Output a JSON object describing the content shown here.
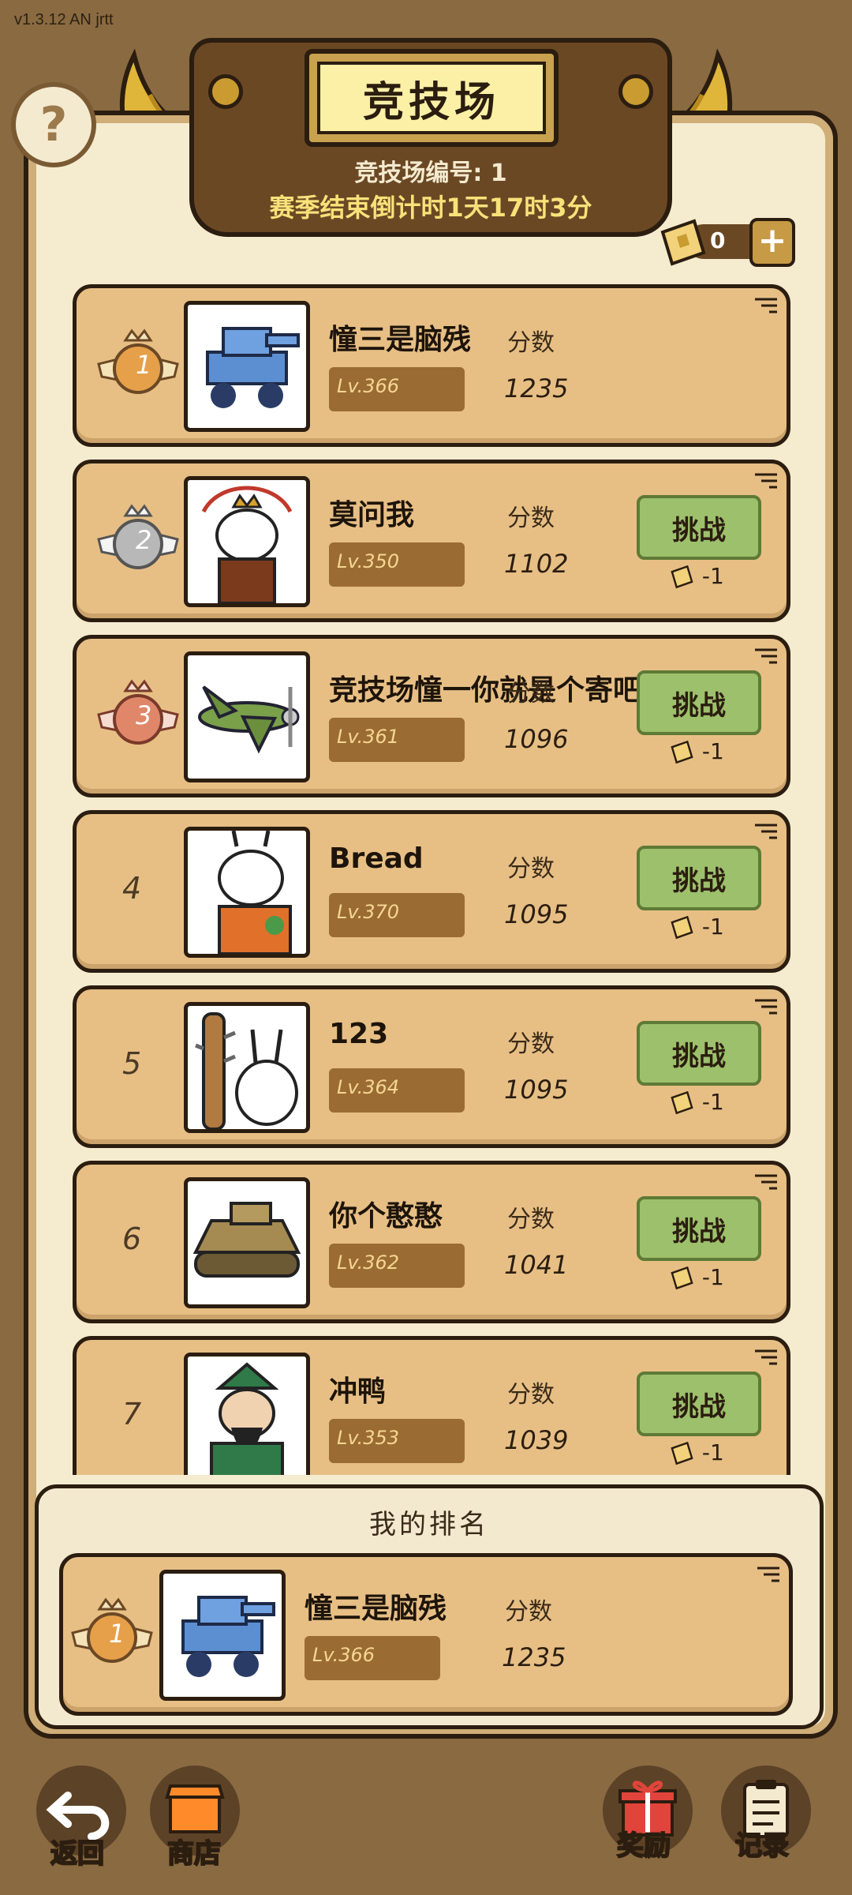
{
  "app": {
    "version": "v1.3.12 AN jrtt"
  },
  "header": {
    "help_glyph": "?",
    "title": "竞技场",
    "arena_number": "竞技场编号: 1",
    "season_countdown": "赛季结束倒计时1天17时3分"
  },
  "tickets": {
    "count": "0",
    "add_glyph": "+"
  },
  "score_label": "分数",
  "challenge_label": "挑战",
  "cost_label": "-1",
  "ranks": [
    {
      "rank": "1",
      "name": "憧三是脑残",
      "level": "Lv.366",
      "score": "1235",
      "medal": "gold",
      "portrait": "blue-tank",
      "challenge": false
    },
    {
      "rank": "2",
      "name": "莫问我",
      "level": "Lv.350",
      "score": "1102",
      "medal": "silver",
      "portrait": "monkey-king-rabbit",
      "challenge": true
    },
    {
      "rank": "3",
      "name": "竞技场憧一你就是个寄吧",
      "level": "Lv.361",
      "score": "1096",
      "medal": "bronze",
      "portrait": "green-plane",
      "challenge": true
    },
    {
      "rank": "4",
      "name": "Bread",
      "level": "Lv.370",
      "score": "1095",
      "medal": "none",
      "portrait": "chef-rabbit",
      "challenge": true
    },
    {
      "rank": "5",
      "name": "123",
      "level": "Lv.364",
      "score": "1095",
      "medal": "none",
      "portrait": "club-rabbit",
      "challenge": true
    },
    {
      "rank": "6",
      "name": "你个憨憨",
      "level": "Lv.362",
      "score": "1041",
      "medal": "none",
      "portrait": "khaki-tank",
      "challenge": true
    },
    {
      "rank": "7",
      "name": "冲鸭",
      "level": "Lv.353",
      "score": "1039",
      "medal": "none",
      "portrait": "general-rabbit",
      "challenge": true
    }
  ],
  "my_ranking": {
    "title": "我的排名",
    "rank": "1",
    "name": "憧三是脑残",
    "level": "Lv.366",
    "score": "1235"
  },
  "bottom_nav": {
    "back": "返回",
    "shop": "商店",
    "rewards": "奖励",
    "records": "记录"
  },
  "colors": {
    "gold": "#e6a04a",
    "silver": "#b8b8b8",
    "bronze": "#e0876a",
    "challenge_green": "#9dc06c"
  }
}
